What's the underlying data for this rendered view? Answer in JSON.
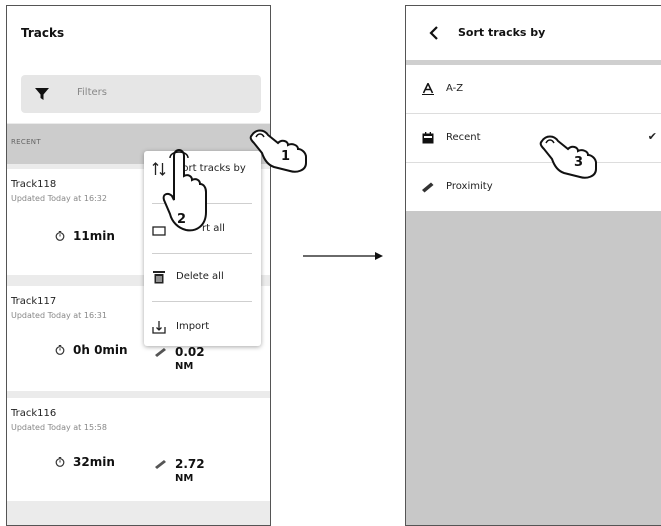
{
  "left_screen": {
    "title": "Tracks",
    "filter_placeholder": "Filters",
    "section_label": "RECENT",
    "tracks": [
      {
        "name": "Track118",
        "updated": "Updated Today at 16:32",
        "duration": "11min",
        "distance": "",
        "unit": ""
      },
      {
        "name": "Track117",
        "updated": "Updated Today at 16:31",
        "duration": "0h 0min",
        "distance": "0.02",
        "unit": "NM"
      },
      {
        "name": "Track116",
        "updated": "Updated Today at 15:58",
        "duration": "32min",
        "distance": "2.72",
        "unit": "NM"
      }
    ],
    "menu": {
      "items": [
        {
          "label": "Sort tracks by",
          "icon": "sort-arrows-icon"
        },
        {
          "label": "rt all",
          "icon": "export-icon"
        },
        {
          "label": "Delete all",
          "icon": "trash-icon"
        },
        {
          "label": "Import",
          "icon": "import-icon"
        }
      ]
    }
  },
  "right_screen": {
    "title": "Sort tracks by",
    "options": [
      {
        "label": "A-Z",
        "icon": "alphabet-icon",
        "selected": false
      },
      {
        "label": "Recent",
        "icon": "calendar-icon",
        "selected": true,
        "check": "✔"
      },
      {
        "label": "Proximity",
        "icon": "ruler-icon",
        "selected": false
      }
    ]
  },
  "annotations": {
    "step1": "1",
    "step2": "2",
    "step3": "3"
  },
  "colors": {
    "background_gray": "#cccccc",
    "card_white": "#ffffff",
    "text_dark": "#111111",
    "text_muted": "#888888"
  }
}
